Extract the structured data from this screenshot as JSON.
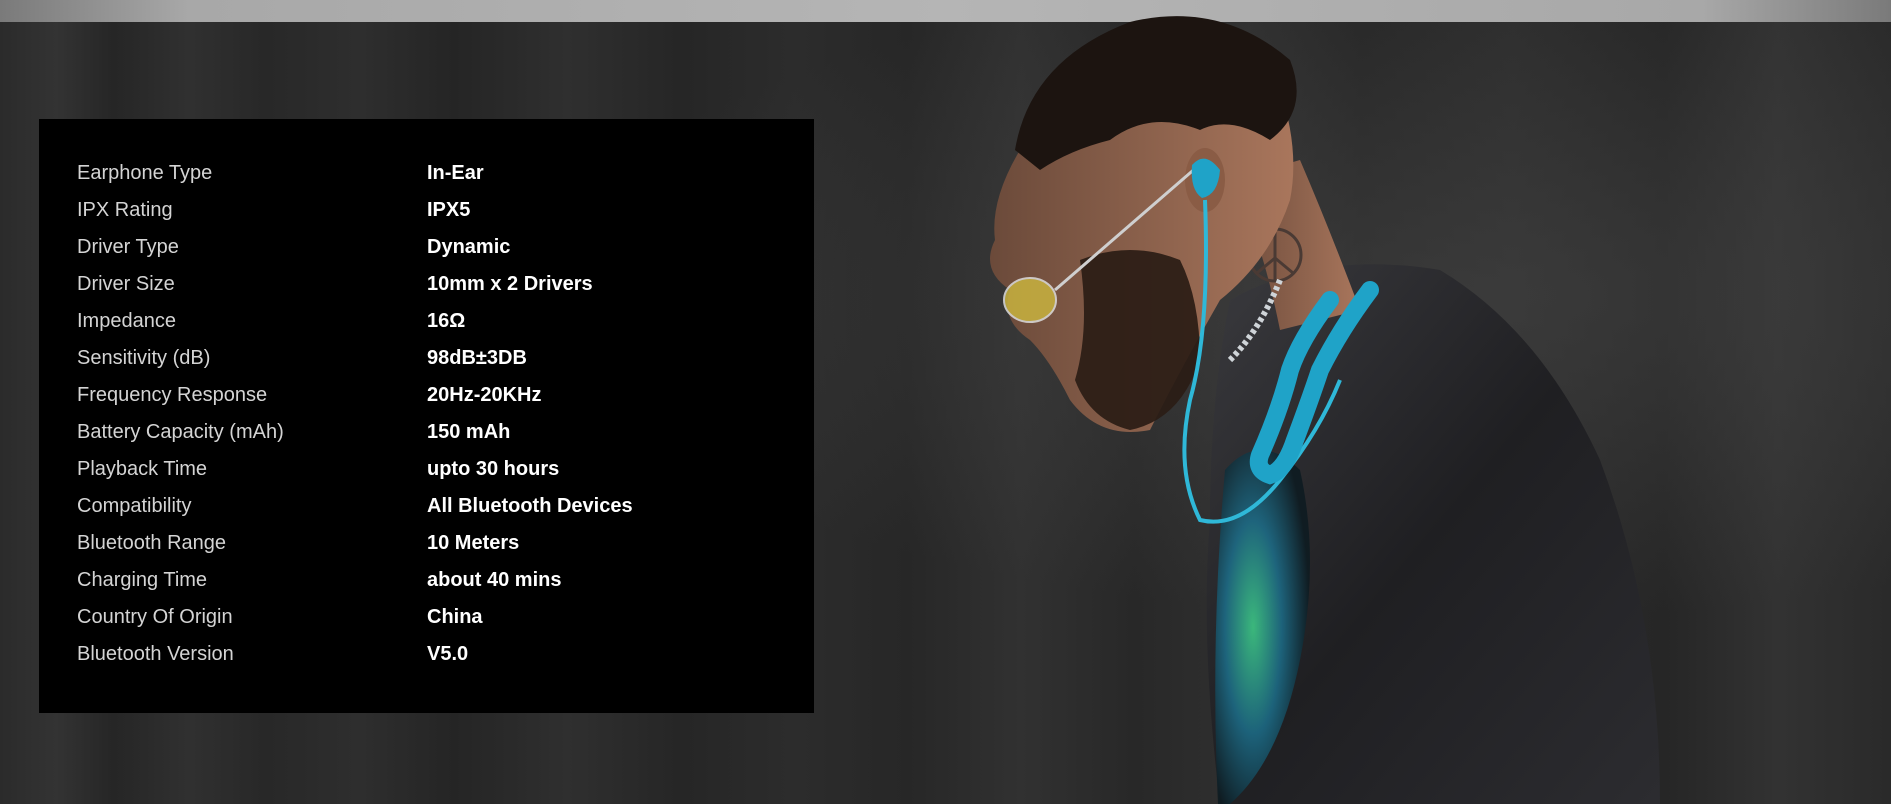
{
  "specs": [
    {
      "label": "Earphone Type",
      "value": "In-Ear"
    },
    {
      "label": "IPX Rating",
      "value": "IPX5"
    },
    {
      "label": "Driver Type",
      "value": "Dynamic"
    },
    {
      "label": "Driver Size",
      "value": "10mm x 2 Drivers"
    },
    {
      "label": "Impedance",
      "value": "16Ω"
    },
    {
      "label": "Sensitivity (dB)",
      "value": "98dB±3DB"
    },
    {
      "label": "Frequency Response",
      "value": "20Hz-20KHz"
    },
    {
      "label": "Battery Capacity (mAh)",
      "value": "150 mAh"
    },
    {
      "label": "Playback Time",
      "value": "upto 30 hours"
    },
    {
      "label": "Compatibility",
      "value": "All Bluetooth Devices"
    },
    {
      "label": "Bluetooth Range",
      "value": "10 Meters"
    },
    {
      "label": "Charging Time",
      "value": "about 40 mins"
    },
    {
      "label": "Country Of Origin",
      "value": "China"
    },
    {
      "label": "Bluetooth Version",
      "value": "V5.0"
    }
  ],
  "colors": {
    "panel_background": "#000000",
    "page_background": "#2a2a2a",
    "label_text": "#d4d4d4",
    "value_text": "#ffffff",
    "earphone_accent": "#1fa3c8"
  },
  "hero": {
    "icon": "model-wearing-neckband-earphones-image"
  }
}
